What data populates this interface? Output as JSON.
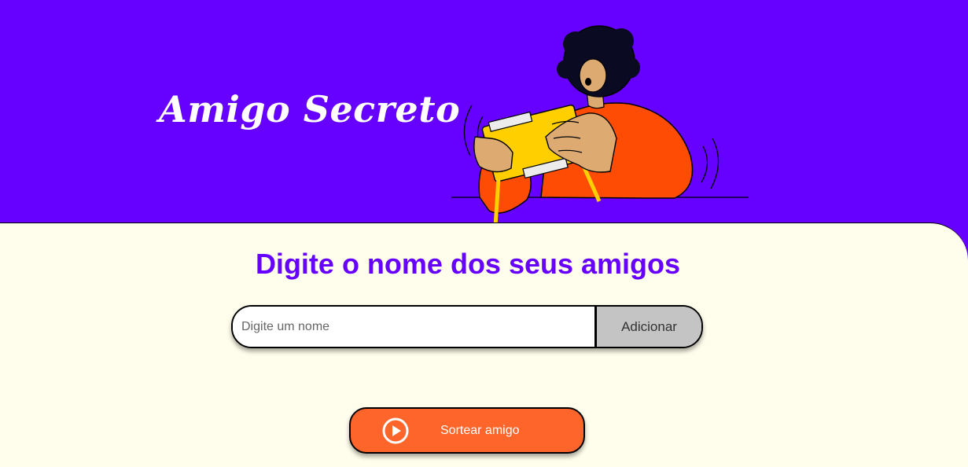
{
  "header": {
    "title": "Amigo Secreto",
    "illustration_icon": "person-opening-gift-illustration"
  },
  "main": {
    "heading": "Digite o nome dos seus amigos",
    "name_input": {
      "placeholder": "Digite um nome",
      "value": ""
    },
    "add_button_label": "Adicionar",
    "draw_button": {
      "label": "Sortear amigo",
      "icon": "play-circle-icon"
    }
  },
  "colors": {
    "header_background": "#6600FF",
    "content_background": "#FFFDEB",
    "heading_color": "#6600FF",
    "add_button_background": "#C4C4C4",
    "draw_button_background": "#FE652B"
  }
}
